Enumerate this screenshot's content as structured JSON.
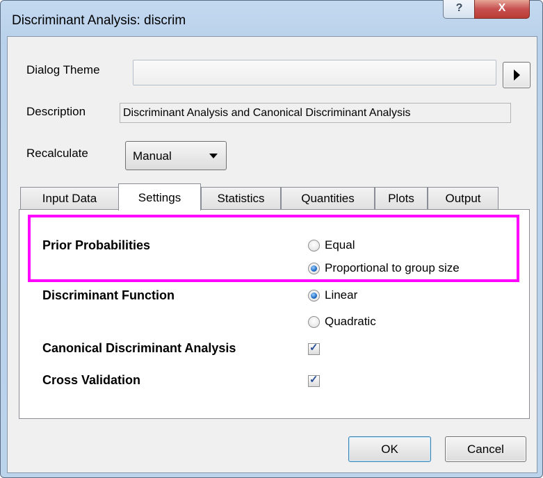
{
  "window": {
    "title": "Discriminant Analysis: discrim",
    "help_symbol": "?",
    "close_symbol": "X"
  },
  "dialog_theme": {
    "label": "Dialog Theme",
    "value": ""
  },
  "description": {
    "label": "Description",
    "value": "Discriminant Analysis and Canonical Discriminant Analysis"
  },
  "recalculate": {
    "label": "Recalculate",
    "value": "Manual"
  },
  "tabs": [
    {
      "label": "Input Data"
    },
    {
      "label": "Settings",
      "active": true
    },
    {
      "label": "Statistics"
    },
    {
      "label": "Quantities"
    },
    {
      "label": "Plots"
    },
    {
      "label": "Output"
    }
  ],
  "settings": {
    "prior_probabilities": {
      "label": "Prior Probabilities",
      "options": [
        "Equal",
        "Proportional to group size"
      ],
      "selected": "Proportional to group size"
    },
    "discriminant_function": {
      "label": "Discriminant Function",
      "options": [
        "Linear",
        "Quadratic"
      ],
      "selected": "Linear"
    },
    "canonical": {
      "label": "Canonical Discriminant Analysis",
      "checked": true
    },
    "cross_validation": {
      "label": "Cross Validation",
      "checked": true
    }
  },
  "buttons": {
    "ok": "OK",
    "cancel": "Cancel"
  },
  "colors": {
    "highlight": "#ff00ff",
    "title_bar": "#b9d1ea",
    "close_button": "#c75050"
  }
}
